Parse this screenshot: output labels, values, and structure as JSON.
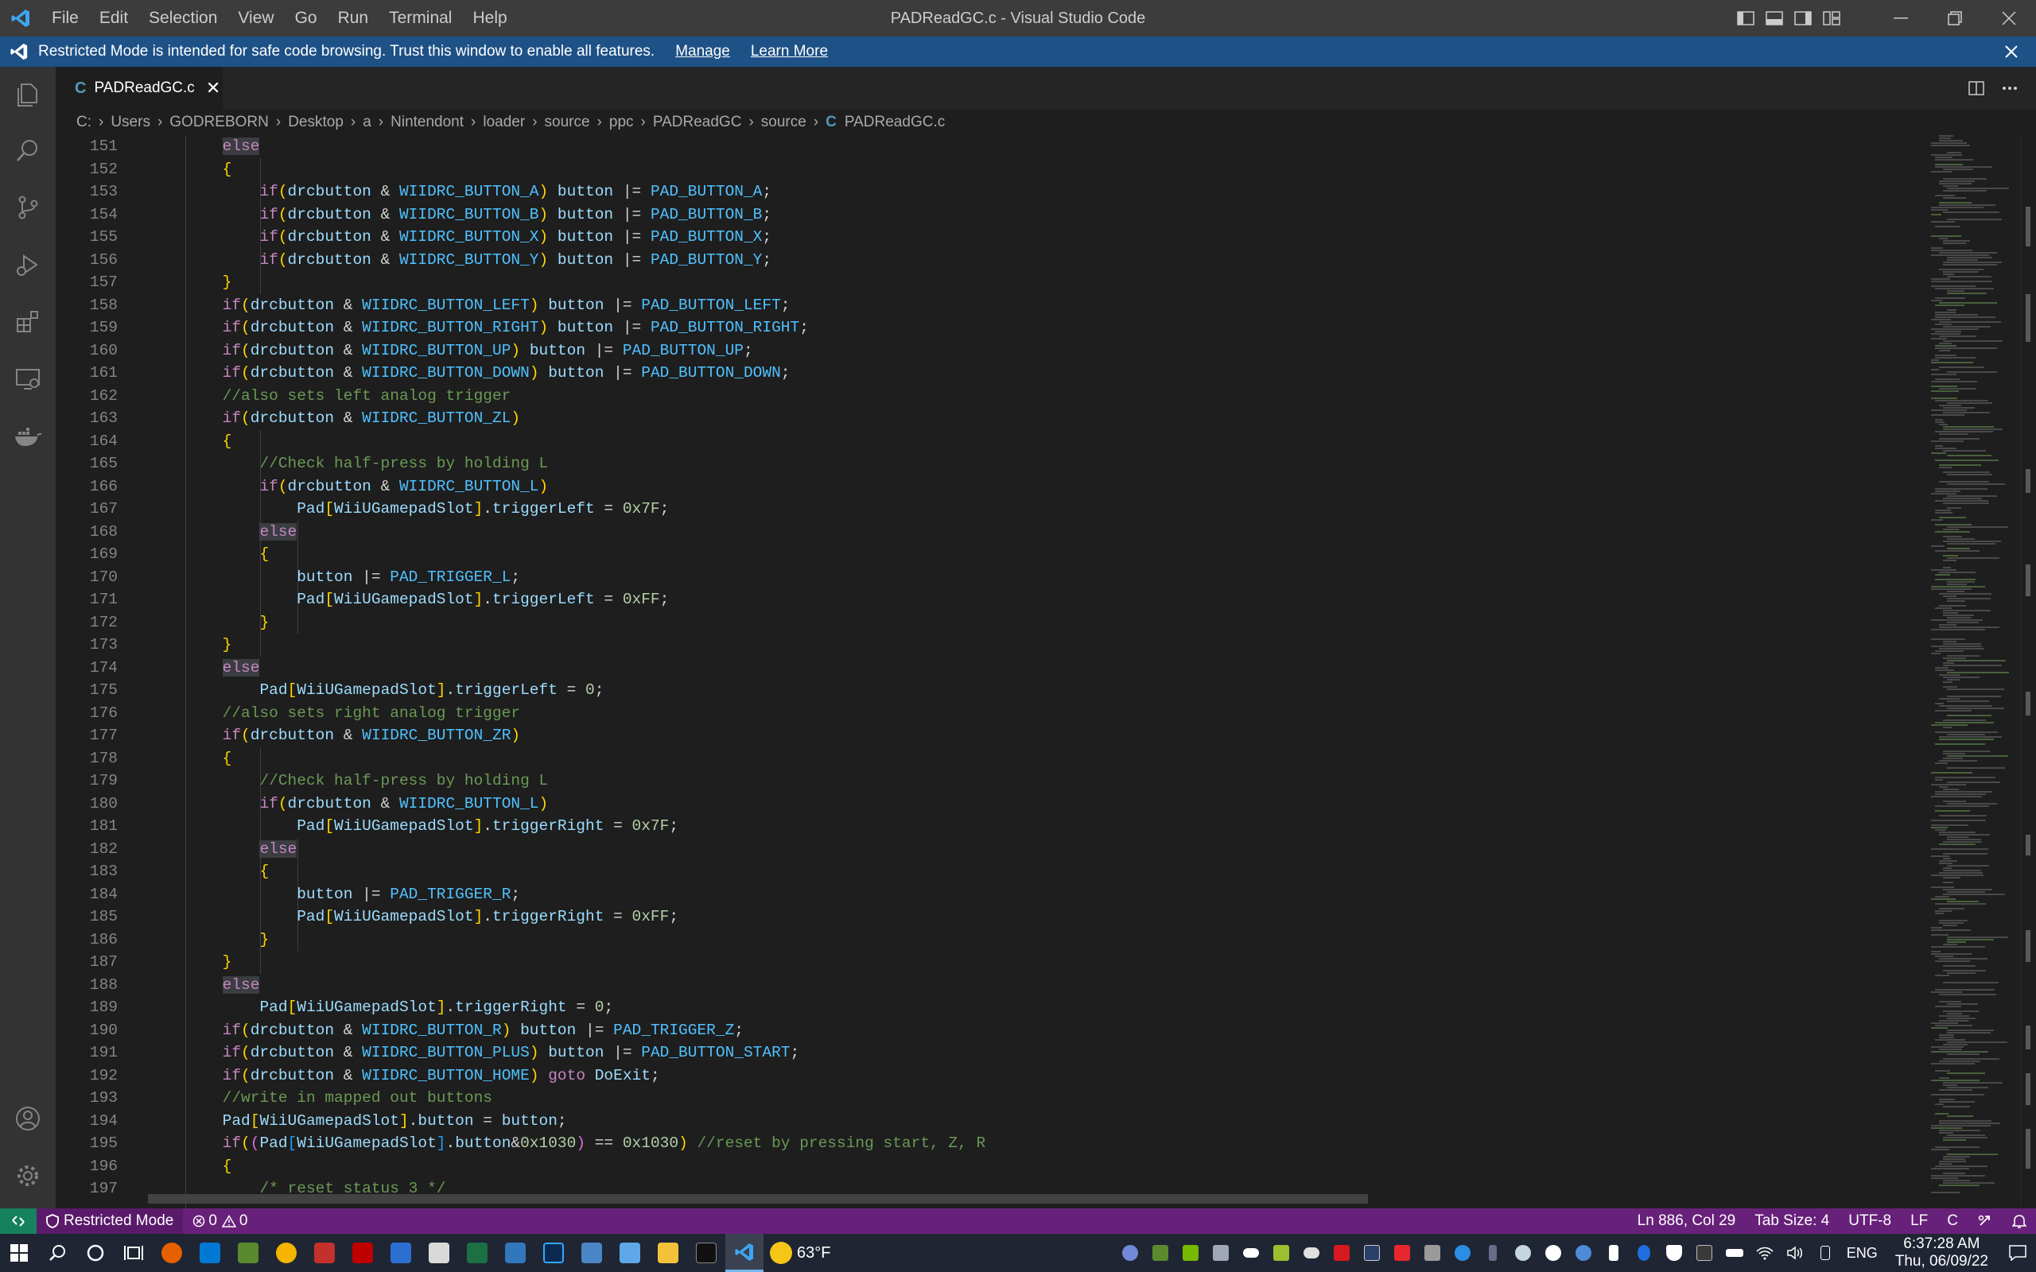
{
  "app": {
    "title": "PADReadGC.c - Visual Studio Code",
    "menu": [
      "File",
      "Edit",
      "Selection",
      "View",
      "Go",
      "Run",
      "Terminal",
      "Help"
    ]
  },
  "banner": {
    "text": "Restricted Mode is intended for safe code browsing. Trust this window to enable all features.",
    "manage": "Manage",
    "learn_more": "Learn More"
  },
  "tab": {
    "icon_letter": "C",
    "name": "PADReadGC.c",
    "close": "✕"
  },
  "breadcrumb": [
    "C:",
    "Users",
    "GODREBORN",
    "Desktop",
    "a",
    "Nintendont",
    "loader",
    "source",
    "ppc",
    "PADReadGC",
    "source",
    "PADReadGC.c"
  ],
  "breadcrumb_file_icon": "C",
  "lines": [
    {
      "n": "151",
      "t": "        else"
    },
    {
      "n": "152",
      "t": "        {"
    },
    {
      "n": "153",
      "t": "            if(drcbutton & WIIDRC_BUTTON_A) button |= PAD_BUTTON_A;"
    },
    {
      "n": "154",
      "t": "            if(drcbutton & WIIDRC_BUTTON_B) button |= PAD_BUTTON_B;"
    },
    {
      "n": "155",
      "t": "            if(drcbutton & WIIDRC_BUTTON_X) button |= PAD_BUTTON_X;"
    },
    {
      "n": "156",
      "t": "            if(drcbutton & WIIDRC_BUTTON_Y) button |= PAD_BUTTON_Y;"
    },
    {
      "n": "157",
      "t": "        }"
    },
    {
      "n": "158",
      "t": "        if(drcbutton & WIIDRC_BUTTON_LEFT) button |= PAD_BUTTON_LEFT;"
    },
    {
      "n": "159",
      "t": "        if(drcbutton & WIIDRC_BUTTON_RIGHT) button |= PAD_BUTTON_RIGHT;"
    },
    {
      "n": "160",
      "t": "        if(drcbutton & WIIDRC_BUTTON_UP) button |= PAD_BUTTON_UP;"
    },
    {
      "n": "161",
      "t": "        if(drcbutton & WIIDRC_BUTTON_DOWN) button |= PAD_BUTTON_DOWN;"
    },
    {
      "n": "162",
      "t": "        //also sets left analog trigger"
    },
    {
      "n": "163",
      "t": "        if(drcbutton & WIIDRC_BUTTON_ZL)"
    },
    {
      "n": "164",
      "t": "        {"
    },
    {
      "n": "165",
      "t": "            //Check half-press by holding L"
    },
    {
      "n": "166",
      "t": "            if(drcbutton & WIIDRC_BUTTON_L)"
    },
    {
      "n": "167",
      "t": "                Pad[WiiUGamepadSlot].triggerLeft = 0x7F;"
    },
    {
      "n": "168",
      "t": "            else"
    },
    {
      "n": "169",
      "t": "            {"
    },
    {
      "n": "170",
      "t": "                button |= PAD_TRIGGER_L;"
    },
    {
      "n": "171",
      "t": "                Pad[WiiUGamepadSlot].triggerLeft = 0xFF;"
    },
    {
      "n": "172",
      "t": "            }"
    },
    {
      "n": "173",
      "t": "        }"
    },
    {
      "n": "174",
      "t": "        else"
    },
    {
      "n": "175",
      "t": "            Pad[WiiUGamepadSlot].triggerLeft = 0;"
    },
    {
      "n": "176",
      "t": "        //also sets right analog trigger"
    },
    {
      "n": "177",
      "t": "        if(drcbutton & WIIDRC_BUTTON_ZR)"
    },
    {
      "n": "178",
      "t": "        {"
    },
    {
      "n": "179",
      "t": "            //Check half-press by holding L"
    },
    {
      "n": "180",
      "t": "            if(drcbutton & WIIDRC_BUTTON_L)"
    },
    {
      "n": "181",
      "t": "                Pad[WiiUGamepadSlot].triggerRight = 0x7F;"
    },
    {
      "n": "182",
      "t": "            else"
    },
    {
      "n": "183",
      "t": "            {"
    },
    {
      "n": "184",
      "t": "                button |= PAD_TRIGGER_R;"
    },
    {
      "n": "185",
      "t": "                Pad[WiiUGamepadSlot].triggerRight = 0xFF;"
    },
    {
      "n": "186",
      "t": "            }"
    },
    {
      "n": "187",
      "t": "        }"
    },
    {
      "n": "188",
      "t": "        else"
    },
    {
      "n": "189",
      "t": "            Pad[WiiUGamepadSlot].triggerRight = 0;"
    },
    {
      "n": "190",
      "t": "        if(drcbutton & WIIDRC_BUTTON_R) button |= PAD_TRIGGER_Z;"
    },
    {
      "n": "191",
      "t": "        if(drcbutton & WIIDRC_BUTTON_PLUS) button |= PAD_BUTTON_START;"
    },
    {
      "n": "192",
      "t": "        if(drcbutton & WIIDRC_BUTTON_HOME) goto DoExit;"
    },
    {
      "n": "193",
      "t": "        //write in mapped out buttons"
    },
    {
      "n": "194",
      "t": "        Pad[WiiUGamepadSlot].button = button;"
    },
    {
      "n": "195",
      "t": "        if((Pad[WiiUGamepadSlot].button&0x1030) == 0x1030) //reset by pressing start, Z, R"
    },
    {
      "n": "196",
      "t": "        {"
    },
    {
      "n": "197",
      "t": "            /* reset status 3 */"
    }
  ],
  "status": {
    "mode": "Restricted Mode",
    "errors": "0",
    "warnings": "0",
    "position": "Ln 886, Col 29",
    "tab_size": "Tab Size: 4",
    "encoding": "UTF-8",
    "eol": "LF",
    "language": "C"
  },
  "taskbar": {
    "weather": "63°F",
    "language": "ENG",
    "time": "6:37:28 AM",
    "date": "Thu, 06/09/22"
  },
  "colors": {
    "accent_banner": "#1e5186",
    "statusbar": "#68217a",
    "remote": "#16825d"
  }
}
